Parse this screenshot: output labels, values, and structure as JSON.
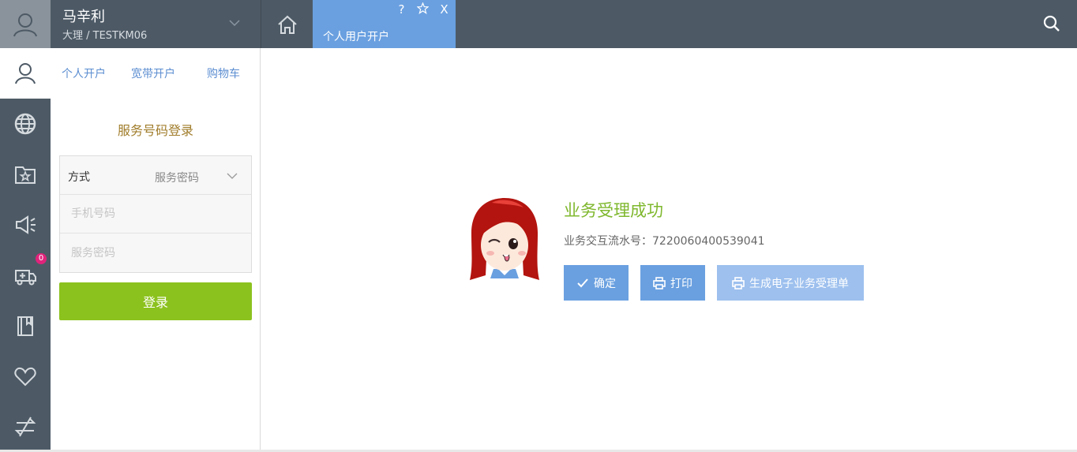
{
  "user": {
    "name": "马辛利",
    "subtitle": "大理 / TESTKM06"
  },
  "tabs": [
    {
      "label": "个人用户开户",
      "help_icon": "question-icon",
      "star_icon": "star-icon",
      "close_icon": "close-icon"
    }
  ],
  "tab_glyphs": {
    "help": "?",
    "close": "X"
  },
  "rail": [
    {
      "icon": "user-icon",
      "active": true
    },
    {
      "icon": "globe-icon"
    },
    {
      "icon": "folder-star-icon"
    },
    {
      "icon": "megaphone-icon"
    },
    {
      "icon": "ambulance-icon",
      "badge": "0"
    },
    {
      "icon": "book-icon"
    },
    {
      "icon": "heart-icon"
    },
    {
      "icon": "exchange-icon"
    }
  ],
  "panel": {
    "tabs": [
      "个人开户",
      "宽带开户",
      "购物车"
    ],
    "login_title": "服务号码登录",
    "method_label": "方式",
    "method_value": "服务密码",
    "phone_placeholder": "手机号码",
    "password_placeholder": "服务密码",
    "login_button": "登录"
  },
  "main": {
    "success_title": "业务受理成功",
    "serial_text": "业务交互流水号：7220060400539041",
    "buttons": {
      "confirm": "确定",
      "print": "打印",
      "generate": "生成电子业务受理单"
    }
  },
  "colors": {
    "topbar": "#4d5a66",
    "accent_blue": "#6aa0e0",
    "login_green": "#8cc21e",
    "success_green": "#7fb82e"
  }
}
